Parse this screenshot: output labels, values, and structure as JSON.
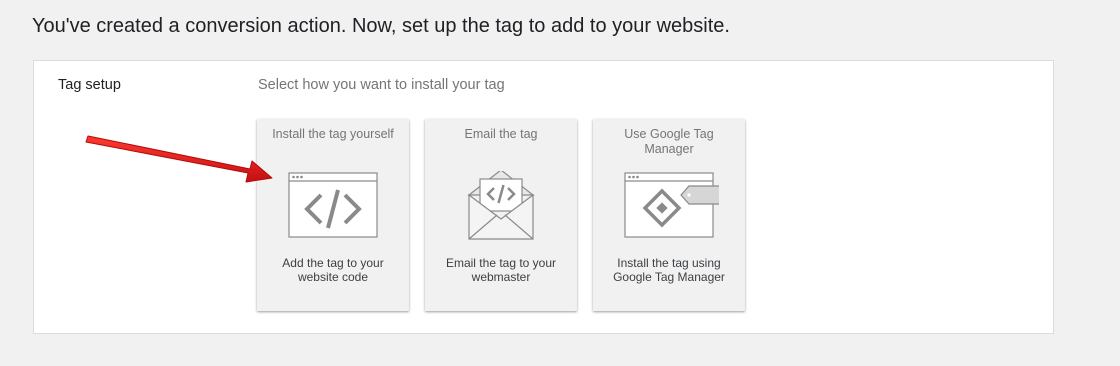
{
  "heading": "You've created a conversion action. Now, set up the tag to add to your website.",
  "tag_setup": {
    "section_label": "Tag setup",
    "instruction": "Select how you want to install your tag",
    "options": [
      {
        "title": "Install the tag yourself",
        "icon": "browser-code-icon",
        "description": "Add the tag to your website code"
      },
      {
        "title": "Email the tag",
        "icon": "envelope-code-icon",
        "description": "Email the tag to your webmaster"
      },
      {
        "title": "Use Google Tag Manager",
        "icon": "tag-manager-icon",
        "description": "Install the tag using Google Tag Manager"
      }
    ]
  },
  "colors": {
    "page_background": "#f1f1f2",
    "panel_background": "#ffffff",
    "card_background": "#f1f1f2",
    "annotation_arrow": "#e8191b"
  }
}
